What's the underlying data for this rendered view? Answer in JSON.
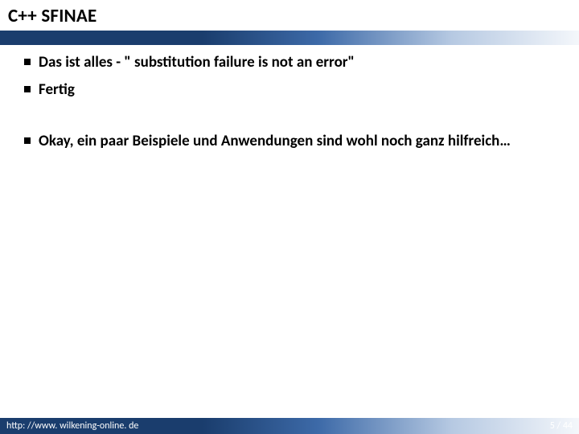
{
  "slide": {
    "title": "C++ SFINAE",
    "bullets": [
      "Das ist alles - \" substitution failure is not an error\"",
      "Fertig"
    ],
    "bullets2": [
      "Okay, ein paar Beispiele und Anwendungen sind wohl noch ganz hilfreich…"
    ]
  },
  "footer": {
    "url": "http: //www. wilkening-online. de",
    "page": "5 / 44"
  }
}
